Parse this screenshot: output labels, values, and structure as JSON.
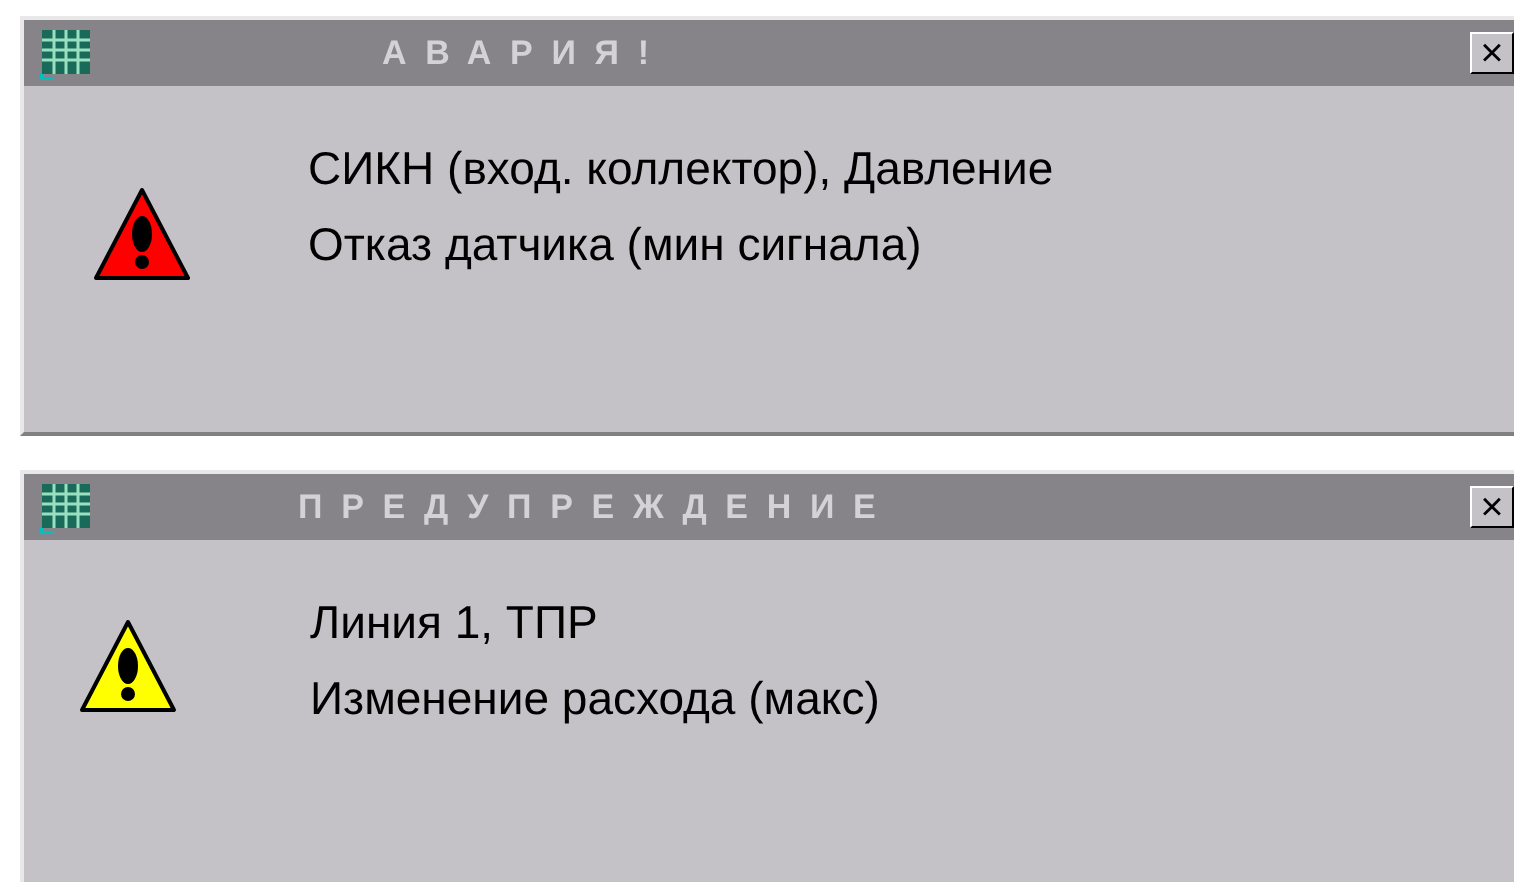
{
  "dialogs": [
    {
      "title": "АВАРИЯ!",
      "kind": "alarm",
      "lines": [
        "СИКН (вход. коллектор), Давление",
        "Отказ датчика (мин сигнала)"
      ],
      "close": "×"
    },
    {
      "title": "ПРЕДУПРЕЖДЕНИЕ",
      "kind": "warning",
      "lines": [
        "Линия 1, ТПР",
        "Изменение расхода (макс)"
      ],
      "close": "×"
    }
  ]
}
